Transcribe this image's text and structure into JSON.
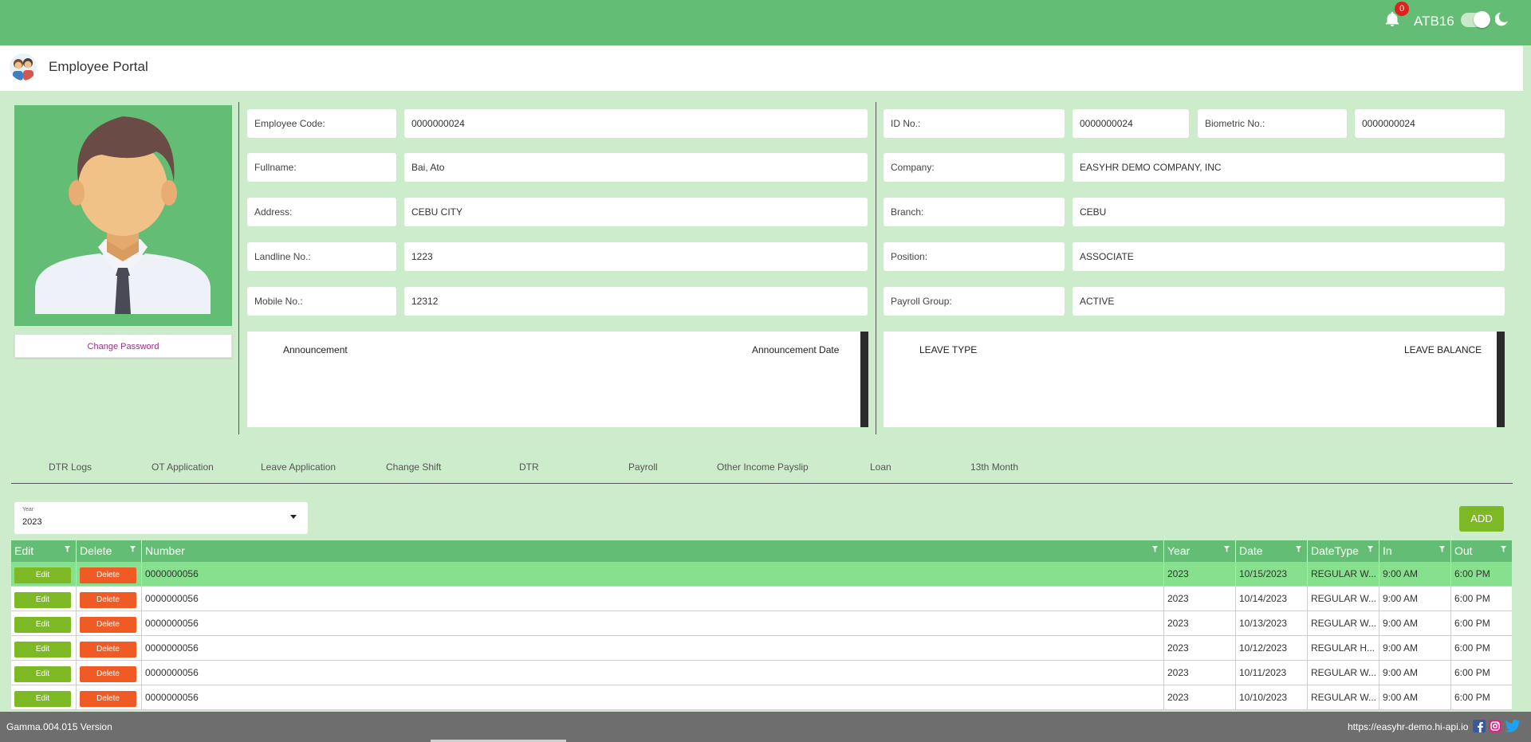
{
  "header": {
    "notifications_count": "0",
    "user": "ATB16",
    "theme_toggle_on": true
  },
  "app": {
    "title": "Employee Portal"
  },
  "profile": {
    "change_password": "Change Password"
  },
  "personal": {
    "employee_code_label": "Employee Code:",
    "employee_code": "0000000024",
    "fullname_label": "Fullname:",
    "fullname": "Bai, Ato",
    "address_label": "Address:",
    "address": "CEBU CITY",
    "landline_label": "Landline No.:",
    "landline": "1223",
    "mobile_label": "Mobile No.:",
    "mobile": "12312"
  },
  "employment": {
    "id_label": "ID No.:",
    "id": "0000000024",
    "biometric_label": "Biometric No.:",
    "biometric": "0000000024",
    "company_label": "Company:",
    "company": "EASYHR DEMO COMPANY, INC",
    "branch_label": "Branch:",
    "branch": "CEBU",
    "position_label": "Position:",
    "position": "ASSOCIATE",
    "payroll_group_label": "Payroll Group:",
    "payroll_group": "ACTIVE"
  },
  "announcements": {
    "col1": "Announcement",
    "col2": "Announcement Date"
  },
  "leaves": {
    "col1": "LEAVE TYPE",
    "col2": "LEAVE BALANCE"
  },
  "tabs": [
    {
      "label": "DTR Logs"
    },
    {
      "label": "OT Application"
    },
    {
      "label": "Leave Application"
    },
    {
      "label": "Change Shift"
    },
    {
      "label": "DTR"
    },
    {
      "label": "Payroll"
    },
    {
      "label": "Other Income Payslip"
    },
    {
      "label": "Loan"
    },
    {
      "label": "13th Month"
    }
  ],
  "filter": {
    "year_label": "Year",
    "year_value": "2023"
  },
  "add_label": "ADD",
  "table": {
    "columns": [
      "Edit",
      "Delete",
      "Number",
      "Year",
      "Date",
      "DateType",
      "In",
      "Out"
    ],
    "edit_label": "Edit",
    "delete_label": "Delete",
    "rows": [
      {
        "number": "0000000056",
        "year": "2023",
        "date": "10/15/2023",
        "datetype": "REGULAR W...",
        "in": "9:00 AM",
        "out": "6:00 PM"
      },
      {
        "number": "0000000056",
        "year": "2023",
        "date": "10/14/2023",
        "datetype": "REGULAR W...",
        "in": "9:00 AM",
        "out": "6:00 PM"
      },
      {
        "number": "0000000056",
        "year": "2023",
        "date": "10/13/2023",
        "datetype": "REGULAR W...",
        "in": "9:00 AM",
        "out": "6:00 PM"
      },
      {
        "number": "0000000056",
        "year": "2023",
        "date": "10/12/2023",
        "datetype": "REGULAR H...",
        "in": "9:00 AM",
        "out": "6:00 PM"
      },
      {
        "number": "0000000056",
        "year": "2023",
        "date": "10/11/2023",
        "datetype": "REGULAR W...",
        "in": "9:00 AM",
        "out": "6:00 PM"
      },
      {
        "number": "0000000056",
        "year": "2023",
        "date": "10/10/2023",
        "datetype": "REGULAR W...",
        "in": "9:00 AM",
        "out": "6:00 PM"
      }
    ]
  },
  "footer": {
    "version": "Gamma.004.015 Version",
    "url": "https://easyhr-demo.hi-api.io"
  },
  "colors": {
    "header_green": "#64bd74",
    "page_bg": "#cdeccb",
    "edit_green": "#7cb924",
    "delete_orange": "#f05a24",
    "selected_row": "#86e08d"
  }
}
